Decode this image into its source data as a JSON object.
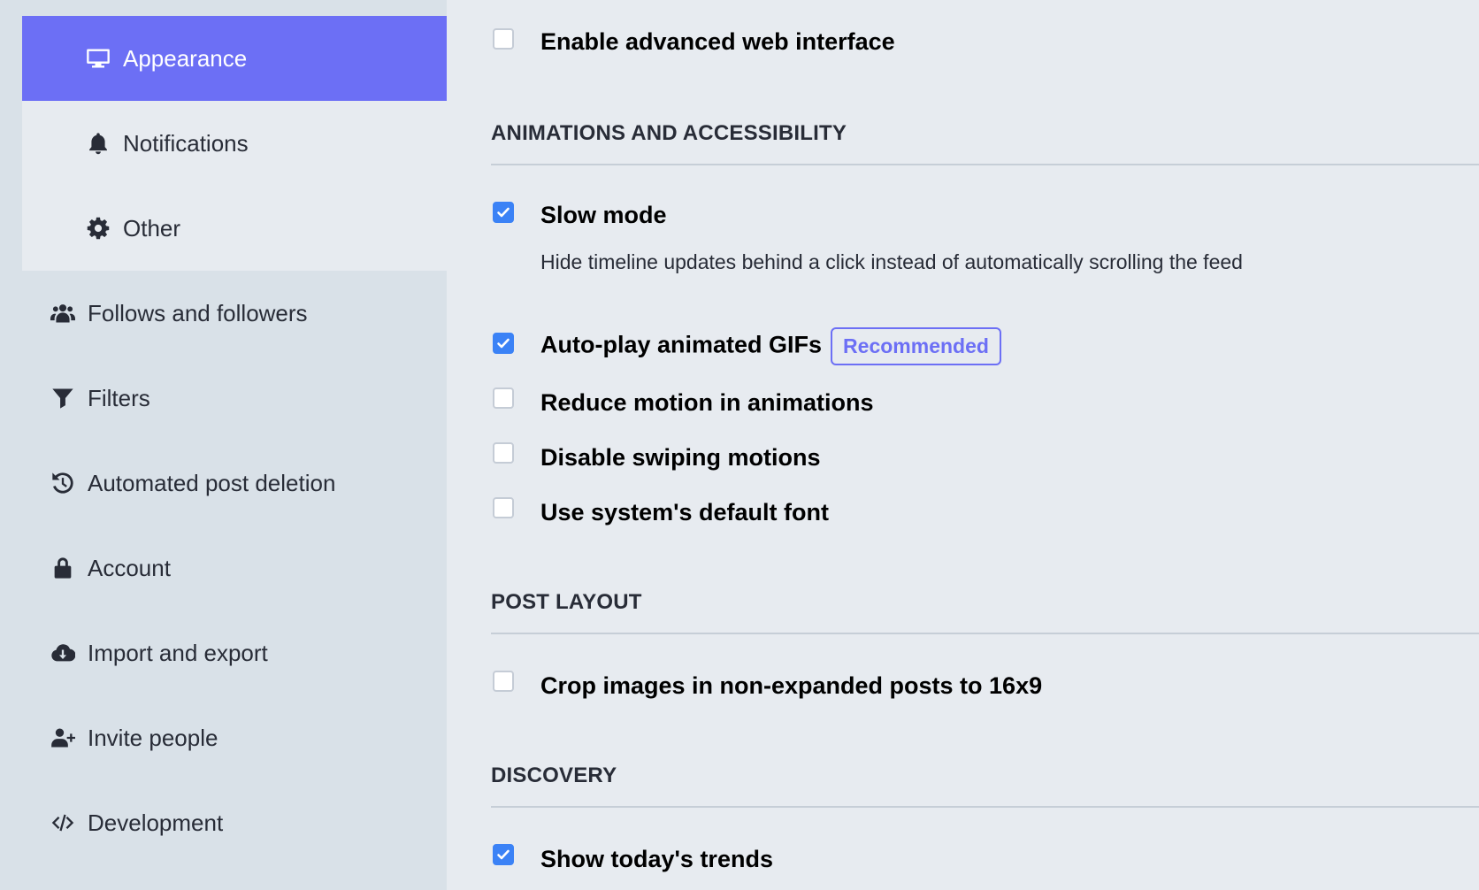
{
  "sidebar": {
    "subnav": [
      {
        "label": "Appearance",
        "icon": "monitor-icon",
        "active": true
      },
      {
        "label": "Notifications",
        "icon": "bell-icon"
      },
      {
        "label": "Other",
        "icon": "gear-icon"
      }
    ],
    "items": [
      {
        "label": "Follows and followers",
        "icon": "users-icon"
      },
      {
        "label": "Filters",
        "icon": "filter-icon"
      },
      {
        "label": "Automated post deletion",
        "icon": "history-icon"
      },
      {
        "label": "Account",
        "icon": "lock-icon"
      },
      {
        "label": "Import and export",
        "icon": "cloud-download-icon"
      },
      {
        "label": "Invite people",
        "icon": "user-plus-icon"
      },
      {
        "label": "Development",
        "icon": "code-icon"
      }
    ]
  },
  "content": {
    "advanced_web": {
      "label": "Enable advanced web interface",
      "checked": false
    },
    "sections": {
      "animations": "ANIMATIONS AND ACCESSIBILITY",
      "post_layout": "POST LAYOUT",
      "discovery": "DISCOVERY"
    },
    "slow_mode": {
      "label": "Slow mode",
      "hint": "Hide timeline updates behind a click instead of automatically scrolling the feed",
      "checked": true
    },
    "autoplay_gifs": {
      "label": "Auto-play animated GIFs",
      "badge": "Recommended",
      "checked": true
    },
    "reduce_motion": {
      "label": "Reduce motion in animations",
      "checked": false
    },
    "disable_swipe": {
      "label": "Disable swiping motions",
      "checked": false
    },
    "system_font": {
      "label": "Use system's default font",
      "checked": false
    },
    "crop_images": {
      "label": "Crop images in non-expanded posts to 16x9",
      "checked": false
    },
    "trends": {
      "label": "Show today's trends",
      "checked": true
    }
  },
  "colors": {
    "accent": "#6c6ff5",
    "checkbox_checked": "#3b82f6",
    "sidebar_bg": "#d9e1e8",
    "content_bg": "#e7ebf0"
  }
}
